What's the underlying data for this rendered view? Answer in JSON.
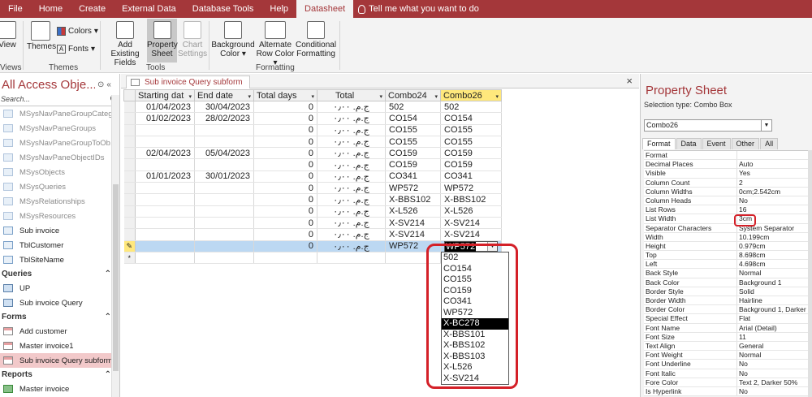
{
  "menu": {
    "items": [
      "File",
      "Home",
      "Create",
      "External Data",
      "Database Tools",
      "Help",
      "Datasheet"
    ],
    "tell_me": "Tell me what you want to do"
  },
  "ribbon": {
    "view": "View",
    "views_group": "Views",
    "themes": "Themes",
    "colors": "Colors",
    "fonts": "Fonts",
    "themes_group": "Themes",
    "add_existing_fields": [
      "Add Existing",
      "Fields"
    ],
    "property_sheet": [
      "Property",
      "Sheet"
    ],
    "chart_settings": [
      "Chart",
      "Settings"
    ],
    "tools_group": "Tools",
    "background_color": [
      "Background",
      "Color"
    ],
    "alternate_row_color": [
      "Alternate",
      "Row Color"
    ],
    "conditional_formatting": [
      "Conditional",
      "Formatting"
    ],
    "formatting_group": "Formatting"
  },
  "nav": {
    "title": "All Access Obje...",
    "search_placeholder": "Search...",
    "tables": [
      "MSysNavPaneGroupCateg...",
      "MSysNavPaneGroups",
      "MSysNavPaneGroupToOb...",
      "MSysNavPaneObjectIDs",
      "MSysObjects",
      "MSysQueries",
      "MSysRelationships",
      "MSysResources"
    ],
    "user_tables": [
      "Sub invoice",
      "TblCustomer",
      "TblSiteName"
    ],
    "queries_label": "Queries",
    "queries": [
      "UP",
      "Sub invoice Query"
    ],
    "forms_label": "Forms",
    "forms": [
      "Add customer",
      "Master invoice1",
      "Sub invoice Query subform"
    ],
    "reports_label": "Reports",
    "reports": [
      "Master invoice"
    ]
  },
  "doc": {
    "tab_label": "Sub invoice Query subform",
    "close": "×"
  },
  "datasheet": {
    "columns": [
      "Starting dat",
      "End date",
      "Total days",
      "Total",
      "Combo24",
      "Combo26"
    ],
    "rows": [
      [
        "01/04/2023",
        "30/04/2023",
        "0",
        "ج.م.‏ ٠٫٠٠",
        "502",
        "502"
      ],
      [
        "01/02/2023",
        "28/02/2023",
        "0",
        "ج.م.‏ ٠٫٠٠",
        "CO154",
        "CO154"
      ],
      [
        "",
        "",
        "0",
        "ج.م.‏ ٠٫٠٠",
        "CO155",
        "CO155"
      ],
      [
        "",
        "",
        "0",
        "ج.م.‏ ٠٫٠٠",
        "CO155",
        "CO155"
      ],
      [
        "02/04/2023",
        "05/04/2023",
        "0",
        "ج.م.‏ ٠٫٠٠",
        "CO159",
        "CO159"
      ],
      [
        "",
        "",
        "0",
        "ج.م.‏ ٠٫٠٠",
        "CO159",
        "CO159"
      ],
      [
        "01/01/2023",
        "30/01/2023",
        "0",
        "ج.م.‏ ٠٫٠٠",
        "CO341",
        "CO341"
      ],
      [
        "",
        "",
        "0",
        "ج.م.‏ ٠٫٠٠",
        "WP572",
        "WP572"
      ],
      [
        "",
        "",
        "0",
        "ج.م.‏ ٠٫٠٠",
        "X-BBS102",
        "X-BBS102"
      ],
      [
        "",
        "",
        "0",
        "ج.م.‏ ٠٫٠٠",
        "X-L526",
        "X-L526"
      ],
      [
        "",
        "",
        "0",
        "ج.م.‏ ٠٫٠٠",
        "X-SV214",
        "X-SV214"
      ],
      [
        "",
        "",
        "0",
        "ج.م.‏ ٠٫٠٠",
        "X-SV214",
        "X-SV214"
      ]
    ],
    "current_row": [
      "",
      "",
      "0",
      "ج.م.‏ ٠٫٠٠",
      "WP572",
      "WP572"
    ],
    "new_row_marker": "*",
    "edit_marker": "✎"
  },
  "dropdown": {
    "options": [
      "502",
      "CO154",
      "CO155",
      "CO159",
      "CO341",
      "WP572",
      "X-BC278",
      "X-BBS101",
      "X-BBS102",
      "X-BBS103",
      "X-L526",
      "X-SV214"
    ],
    "highlighted": "X-BC278"
  },
  "property_sheet": {
    "title": "Property Sheet",
    "selection_type": "Selection type:  Combo Box",
    "object": "Combo26",
    "tabs": [
      "Format",
      "Data",
      "Event",
      "Other",
      "All"
    ],
    "active_tab": "Format",
    "rows": [
      [
        "Format",
        ""
      ],
      [
        "Decimal Places",
        "Auto"
      ],
      [
        "Visible",
        "Yes"
      ],
      [
        "Column Count",
        "2"
      ],
      [
        "Column Widths",
        "0cm;2.542cm"
      ],
      [
        "Column Heads",
        "No"
      ],
      [
        "List Rows",
        "16"
      ],
      [
        "List Width",
        "3cm"
      ],
      [
        "Separator Characters",
        "System Separator"
      ],
      [
        "Width",
        "10.199cm"
      ],
      [
        "Height",
        "0.979cm"
      ],
      [
        "Top",
        "8.698cm"
      ],
      [
        "Left",
        "4.698cm"
      ],
      [
        "Back Style",
        "Normal"
      ],
      [
        "Back Color",
        "Background 1"
      ],
      [
        "Border Style",
        "Solid"
      ],
      [
        "Border Width",
        "Hairline"
      ],
      [
        "Border Color",
        "Background 1, Darker"
      ],
      [
        "Special Effect",
        "Flat"
      ],
      [
        "Font Name",
        "Arial (Detail)"
      ],
      [
        "Font Size",
        "11"
      ],
      [
        "Text Align",
        "General"
      ],
      [
        "Font Weight",
        "Normal"
      ],
      [
        "Font Underline",
        "No"
      ],
      [
        "Font Italic",
        "No"
      ],
      [
        "Fore Color",
        "Text 2, Darker 50%"
      ],
      [
        "Is Hyperlink",
        "No"
      ]
    ]
  },
  "colors": {
    "accent": "#a4373a",
    "highlight": "#ffe87c",
    "selection": "#bcd8f2",
    "annotation": "#d42028"
  }
}
